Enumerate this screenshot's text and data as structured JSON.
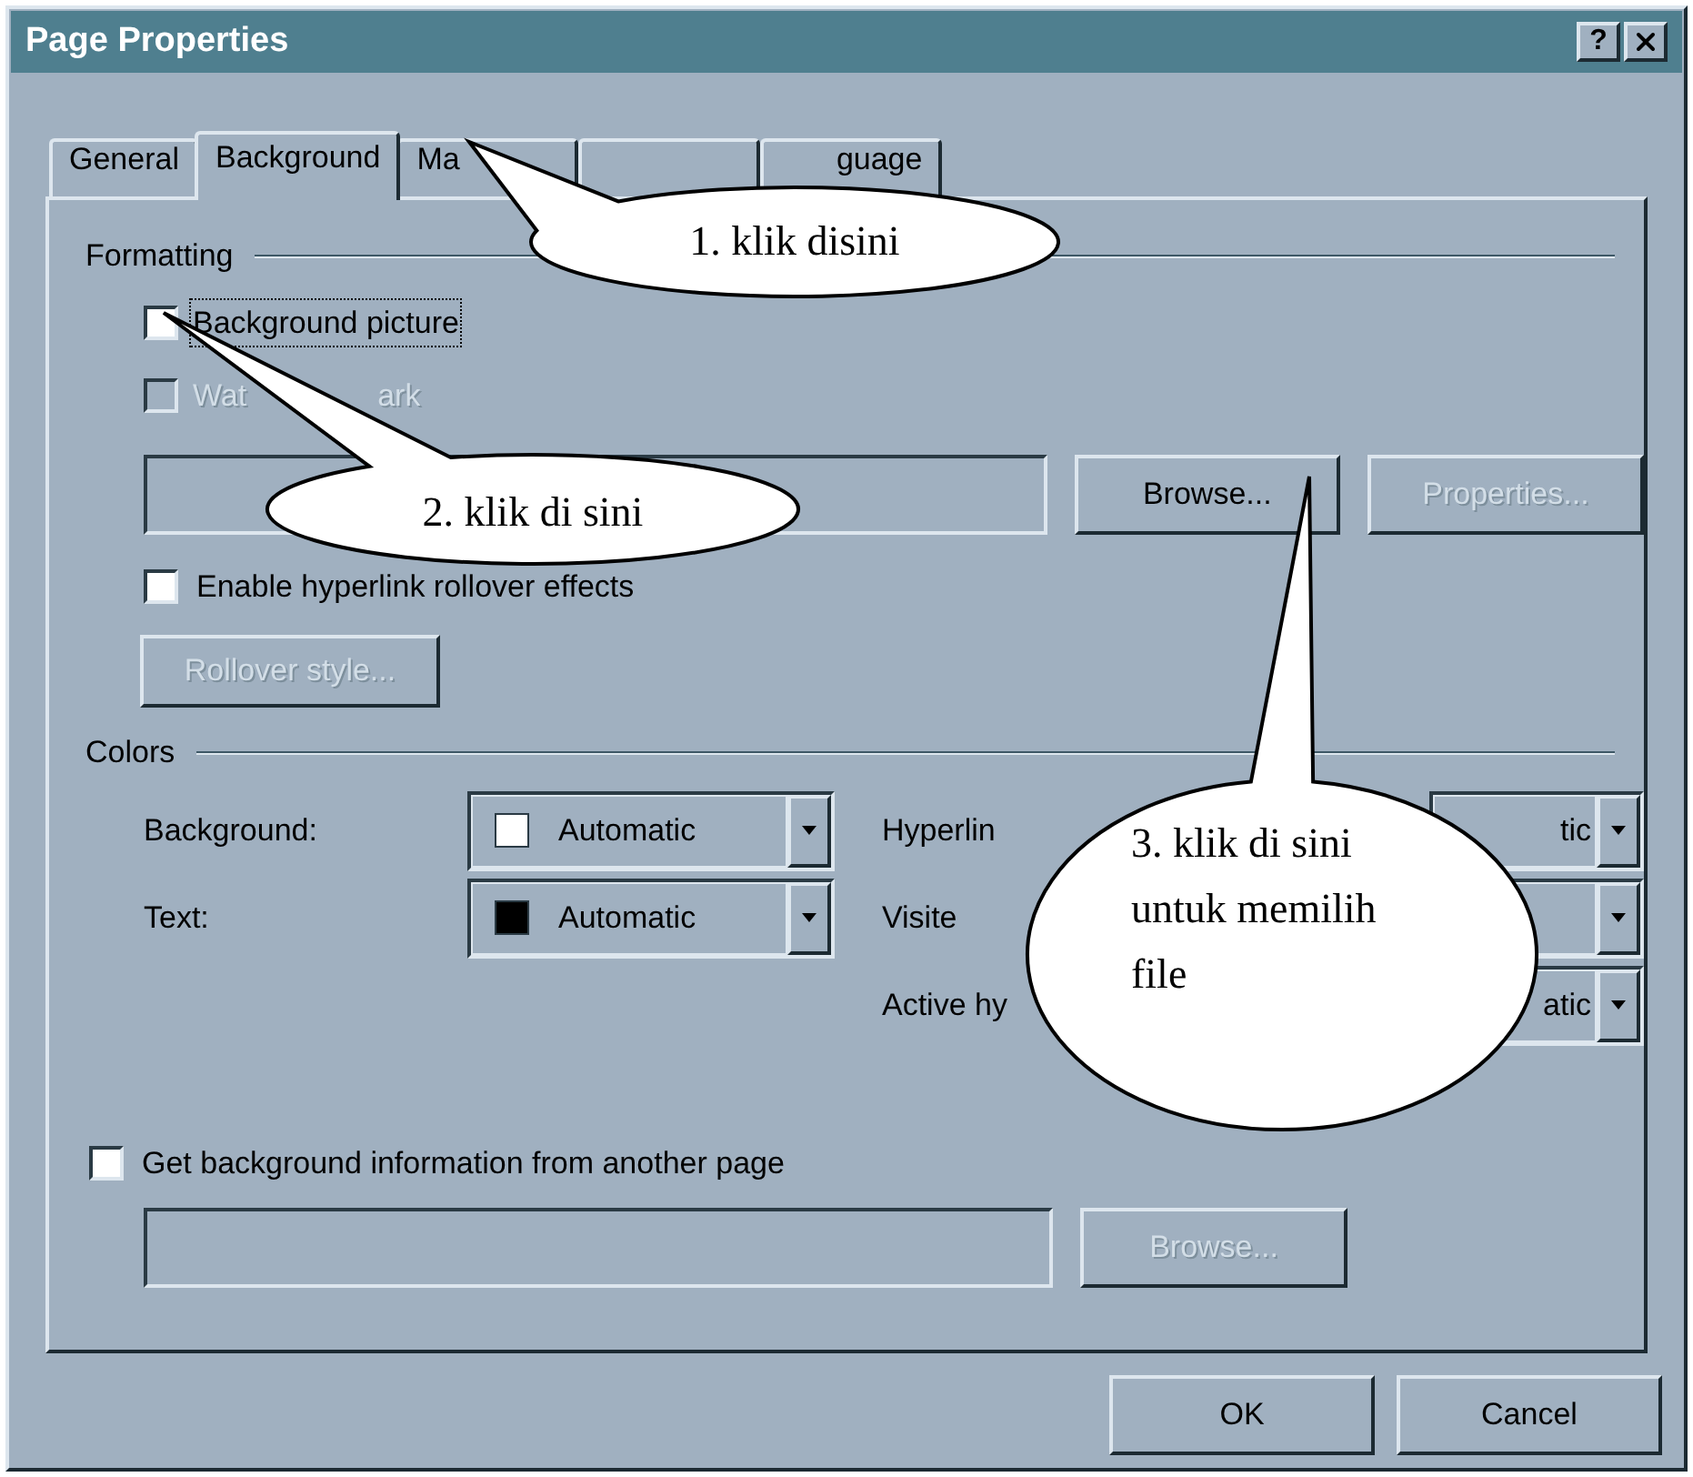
{
  "window": {
    "title": "Page Properties",
    "help": "?"
  },
  "tabs": [
    {
      "label": "General",
      "selected": false
    },
    {
      "label": "Background",
      "selected": true
    },
    {
      "label": "Ma",
      "selected": false
    },
    {
      "selected": false
    },
    {
      "label": "guage",
      "selected": false
    }
  ],
  "formatting": {
    "title": "Formatting",
    "checkboxes": [
      {
        "label_parts": [
          "Background picture"
        ],
        "checked": false,
        "disabled": false,
        "focused": true
      },
      {
        "label_parts": [
          "Wat",
          "ark"
        ],
        "checked": false,
        "disabled": true,
        "focused": false
      }
    ],
    "browse_button": {
      "label": "Browse...",
      "disabled": false
    },
    "properties_button": {
      "label": "Properties...",
      "disabled": true
    },
    "rollover_checkbox": {
      "label": "Enable hyperlink rollover effects",
      "checked": false,
      "disabled": false
    },
    "rollover_button": {
      "label": "Rollover style...",
      "disabled": true
    }
  },
  "colors": {
    "title": "Colors",
    "left": [
      {
        "label": "Background:",
        "color": "#ffffff",
        "value": "Automatic"
      },
      {
        "label": "Text:",
        "color": "#000000",
        "value": "Automatic"
      }
    ],
    "right": [
      {
        "label": "Hyperlin",
        "value": "tic"
      },
      {
        "label": "Visite"
      },
      {
        "label": "Active hy",
        "value": "atic"
      }
    ]
  },
  "other_page": {
    "checkbox": {
      "label": "Get background information from another page",
      "checked": false
    },
    "browse_button": {
      "label": "Browse...",
      "disabled": true
    }
  },
  "buttons": [
    {
      "label": "OK"
    },
    {
      "label": "Cancel"
    }
  ],
  "callouts": [
    {
      "lines": [
        "1. klik disini"
      ]
    },
    {
      "lines": [
        "2. klik di sini"
      ]
    },
    {
      "lines": [
        "3. klik di sini",
        "untuk memilih",
        "file"
      ]
    }
  ]
}
